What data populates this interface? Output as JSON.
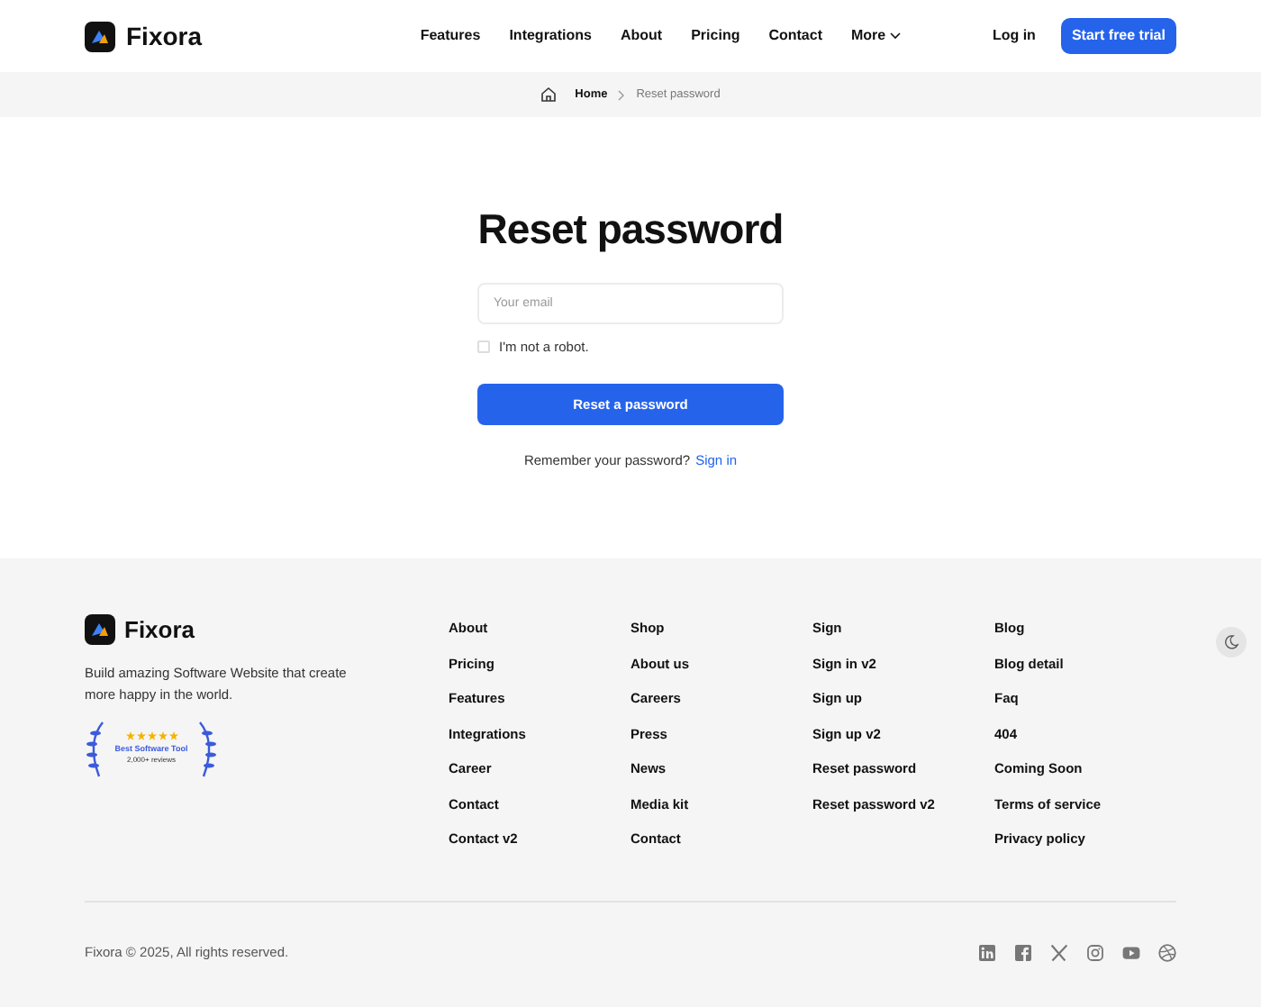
{
  "header": {
    "brand": "Fixora",
    "nav": [
      {
        "label": "Features",
        "dropdown": false
      },
      {
        "label": "Integrations",
        "dropdown": false
      },
      {
        "label": "About",
        "dropdown": false
      },
      {
        "label": "Pricing",
        "dropdown": false
      },
      {
        "label": "Contact",
        "dropdown": false
      },
      {
        "label": "More",
        "dropdown": true
      }
    ],
    "login": "Log in",
    "cta": "Start free trial"
  },
  "breadcrumb": {
    "items": [
      "Home",
      "Reset password"
    ]
  },
  "form": {
    "title": "Reset password",
    "email": {
      "placeholder": "Your email"
    },
    "robot": {
      "label": "I'm not a robot.",
      "checked": false
    },
    "submit": "Reset a password",
    "footer_text": "Remember your password?",
    "footer_link": "Sign in"
  },
  "footer": {
    "brand": "Fixora",
    "tagline": "Build amazing Software Website that create more happy in the world.",
    "badge": {
      "stars": 5,
      "title": "Best Software Tool",
      "subtitle": "2,000+ reviews"
    },
    "columns": [
      [
        "About",
        "Pricing",
        "Features",
        "Integrations",
        "Career",
        "Contact",
        "Contact v2"
      ],
      [
        "Shop",
        "About us",
        "Careers",
        "Press",
        "News",
        "Media kit",
        "Contact"
      ],
      [
        "Sign",
        "Sign in v2",
        "Sign up",
        "Sign up v2",
        "Reset password",
        "Reset password v2"
      ],
      [
        "Blog",
        "Blog detail",
        "Faq",
        "404",
        "Coming Soon",
        "Terms of service",
        "Privacy policy"
      ]
    ],
    "copyright": "Fixora © 2025, All rights reserved."
  }
}
